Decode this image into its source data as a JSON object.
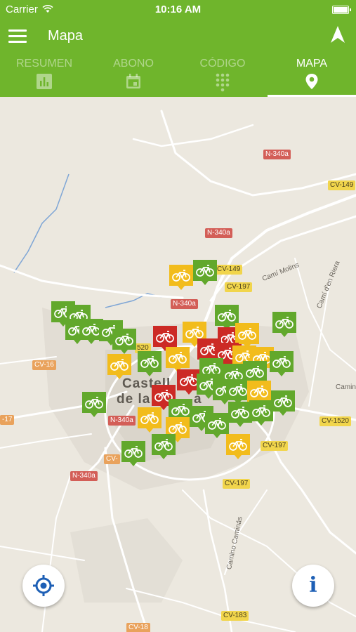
{
  "status_bar": {
    "carrier": "Carrier",
    "time": "10:16 AM"
  },
  "header": {
    "title": "Mapa"
  },
  "tabs": [
    {
      "label": "RESUMEN",
      "icon": "bar-chart-icon",
      "active": false
    },
    {
      "label": "ABONO",
      "icon": "calendar-icon",
      "active": false
    },
    {
      "label": "CÓDIGO",
      "icon": "keypad-icon",
      "active": false
    },
    {
      "label": "MAPA",
      "icon": "map-pin-icon",
      "active": true
    }
  ],
  "map": {
    "town_name_line1": "Castell",
    "town_name_line2": "de la",
    "town_name_partial": "a",
    "road_labels": {
      "n340a_top": "N-340a",
      "n340a_mid": "N-340a",
      "n340a_center": "N-340a",
      "n340a_left": "N-340a",
      "n340a_bottom": "N-340a",
      "cv149_right": "CV-149",
      "cv149_center": "CV-149",
      "cv197_top": "CV-197",
      "cv197_mid": "CV-197",
      "cv197_bottom": "CV-197",
      "cv1520_right": "CV-1520",
      "cv1520_left": "520",
      "cv16": "CV-16",
      "cv17": "-17",
      "cv_partial": "CV-",
      "cv183": "CV-183",
      "cv18": "CV-18"
    },
    "street_labels": {
      "cami_molins": "Camí Molins",
      "cami_riera": "Camí d'en Riera",
      "camino_caminas": "Camino Caminás",
      "camin_right": "Camin"
    },
    "station_colors": {
      "available": "#62a82c",
      "low": "#f2bc1c",
      "empty": "#cc2a25"
    }
  },
  "buttons": {
    "locate_icon": "crosshair-icon",
    "info_label": "i"
  }
}
